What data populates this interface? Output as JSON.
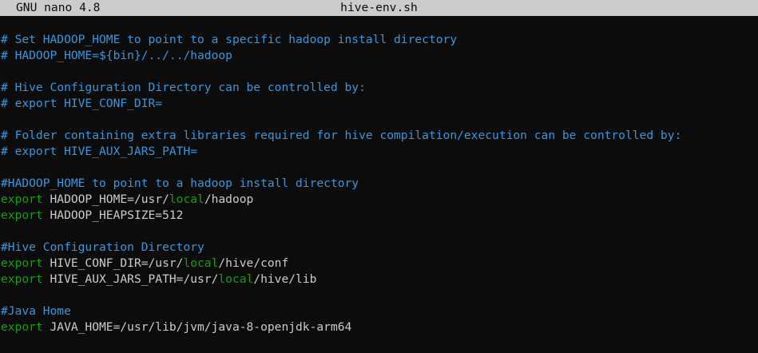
{
  "titlebar": {
    "app": "GNU nano 4.8",
    "filename": "hive-env.sh"
  },
  "lines": [
    {
      "comment": "# Set HADOOP_HOME to point to a specific hadoop install directory"
    },
    {
      "comment": "# HADOOP_HOME=${bin}/../../hadoop"
    },
    {},
    {
      "comment": "# Hive Configuration Directory can be controlled by:"
    },
    {
      "comment": "# export HIVE_CONF_DIR="
    },
    {},
    {
      "comment": "# Folder containing extra libraries required for hive compilation/execution can be controlled by:"
    },
    {
      "comment": "# export HIVE_AUX_JARS_PATH="
    },
    {},
    {
      "comment": "#HADOOP_HOME to point to a hadoop install directory"
    },
    {
      "kw": "export",
      "text": " HADOOP_HOME=/usr/",
      "kw2": "local",
      "text2": "/hadoop"
    },
    {
      "kw": "export",
      "text": " HADOOP_HEAPSIZE=512"
    },
    {},
    {
      "comment": "#Hive Configuration Directory"
    },
    {
      "kw": "export",
      "text": " HIVE_CONF_DIR=/usr/",
      "kw2": "local",
      "text2": "/hive/conf"
    },
    {
      "kw": "export",
      "text": " HIVE_AUX_JARS_PATH=/usr/",
      "kw2": "local",
      "text2": "/hive/lib"
    },
    {},
    {
      "comment": "#Java Home"
    },
    {
      "kw": "export",
      "text": " JAVA_HOME=/usr/lib/jvm/java-8-openjdk-arm64"
    }
  ],
  "colors": {
    "comment": "#3a96dd",
    "keyword": "#13a10e",
    "text": "#cccccc",
    "background": "#0c0c0c",
    "titlebar": "#cccccc"
  }
}
